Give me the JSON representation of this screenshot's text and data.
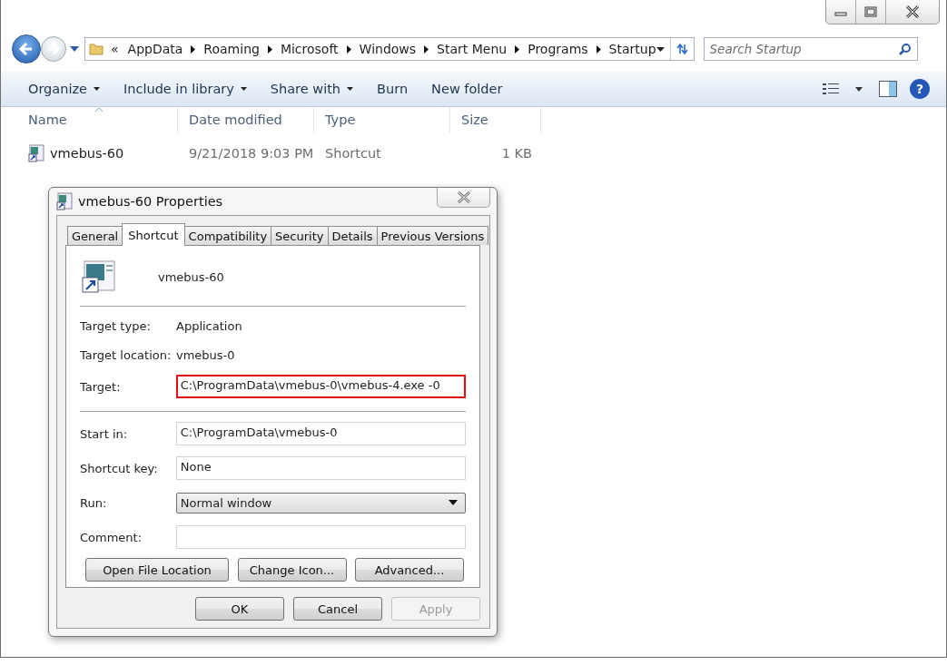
{
  "address_bar": {
    "overflow": "«",
    "crumbs": [
      "AppData",
      "Roaming",
      "Microsoft",
      "Windows",
      "Start Menu",
      "Programs",
      "Startup"
    ]
  },
  "search": {
    "placeholder": "Search Startup"
  },
  "toolbar": {
    "items": [
      {
        "label": "Organize",
        "dropdown": true
      },
      {
        "label": "Include in library",
        "dropdown": true
      },
      {
        "label": "Share with",
        "dropdown": true
      },
      {
        "label": "Burn",
        "dropdown": false
      },
      {
        "label": "New folder",
        "dropdown": false
      }
    ],
    "help": "?"
  },
  "file_list": {
    "columns": [
      {
        "label": "Name",
        "sorted": true
      },
      {
        "label": "Date modified",
        "sorted": false
      },
      {
        "label": "Type",
        "sorted": false
      },
      {
        "label": "Size",
        "sorted": false
      }
    ],
    "rows": [
      {
        "name": "vmebus-60",
        "date": "9/21/2018 9:03 PM",
        "type": "Shortcut",
        "size": "1 KB"
      }
    ]
  },
  "dialog": {
    "title": "vmebus-60 Properties",
    "tabs": [
      {
        "label": "General",
        "selected": false
      },
      {
        "label": "Shortcut",
        "selected": true
      },
      {
        "label": "Compatibility",
        "selected": false
      },
      {
        "label": "Security",
        "selected": false
      },
      {
        "label": "Details",
        "selected": false
      },
      {
        "label": "Previous Versions",
        "selected": false
      }
    ],
    "file_name": "vmebus-60",
    "info": [
      {
        "label": "Target type:",
        "value": "Application"
      },
      {
        "label": "Target location:",
        "value": "vmebus-0"
      }
    ],
    "target": {
      "label": "Target:",
      "value": "C:\\ProgramData\\vmebus-0\\vmebus-4.exe -0",
      "highlighted": true
    },
    "fields": [
      {
        "label": "Start in:",
        "kind": "text",
        "value": "C:\\ProgramData\\vmebus-0"
      },
      {
        "label": "Shortcut key:",
        "kind": "text",
        "value": "None"
      },
      {
        "label": "Run:",
        "kind": "select",
        "value": "Normal window"
      },
      {
        "label": "Comment:",
        "kind": "text"
      }
    ],
    "action_buttons": [
      "Open File Location",
      "Change Icon...",
      "Advanced..."
    ],
    "buttons": [
      {
        "label": "OK",
        "disabled": false
      },
      {
        "label": "Cancel",
        "disabled": false
      },
      {
        "label": "Apply",
        "disabled": true
      }
    ]
  }
}
